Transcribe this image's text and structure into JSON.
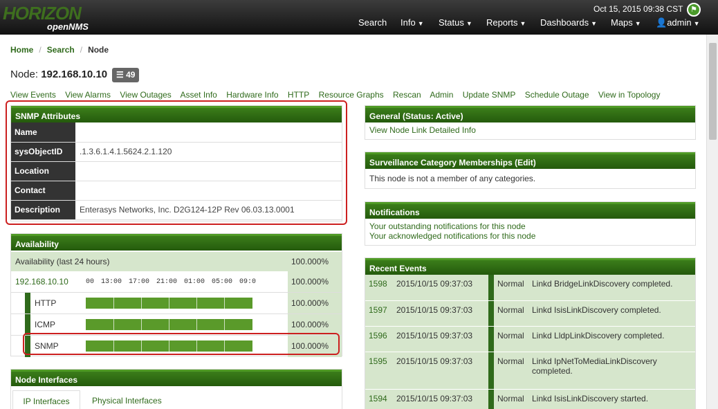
{
  "brand": {
    "name": "HORIZON",
    "sub": "openNMS"
  },
  "clock": "Oct 15, 2015 09:38 CST",
  "nav": [
    "Search",
    "Info",
    "Status",
    "Reports",
    "Dashboards",
    "Maps",
    "admin"
  ],
  "breadcrumb": [
    "Home",
    "Search",
    "Node"
  ],
  "node": {
    "label": "Node:",
    "ip": "192.168.10.10",
    "badge": "49"
  },
  "actions": [
    "View Events",
    "View Alarms",
    "View Outages",
    "Asset Info",
    "Hardware Info",
    "HTTP",
    "Resource Graphs",
    "Rescan",
    "Admin",
    "Update SNMP",
    "Schedule Outage",
    "View in Topology"
  ],
  "snmp": {
    "title": "SNMP Attributes",
    "rows": [
      {
        "k": "Name",
        "v": ""
      },
      {
        "k": "sysObjectID",
        "v": ".1.3.6.1.4.1.5624.2.1.120"
      },
      {
        "k": "Location",
        "v": ""
      },
      {
        "k": "Contact",
        "v": ""
      },
      {
        "k": "Description",
        "v": "Enterasys Networks, Inc. D2G124-12P Rev 06.03.13.0001"
      }
    ]
  },
  "availability": {
    "title": "Availability",
    "summary_label": "Availability (last 24 hours)",
    "summary_pct": "100.000%",
    "ip": "192.168.10.10",
    "ip_pct": "100.000%",
    "times": [
      "00",
      "13:00",
      "17:00",
      "21:00",
      "01:00",
      "05:00",
      "09:0"
    ],
    "services": [
      {
        "name": "HTTP",
        "pct": "100.000%"
      },
      {
        "name": "ICMP",
        "pct": "100.000%"
      },
      {
        "name": "SNMP",
        "pct": "100.000%"
      }
    ]
  },
  "interfaces": {
    "title": "Node Interfaces",
    "tabs": [
      "IP Interfaces",
      "Physical Interfaces"
    ]
  },
  "general": {
    "title": "General (Status: Active)",
    "link": "View Node Link Detailed Info"
  },
  "surveillance": {
    "title": "Surveillance Category Memberships (Edit)",
    "text": "This node is not a member of any categories."
  },
  "notifications": {
    "title": "Notifications",
    "items": [
      "Your outstanding notifications for this node",
      "Your acknowledged notifications for this node"
    ]
  },
  "events": {
    "title": "Recent Events",
    "rows": [
      {
        "id": "1598",
        "time": "2015/10/15 09:37:03",
        "sev": "Normal",
        "msg": "Linkd BridgeLinkDiscovery completed."
      },
      {
        "id": "1597",
        "time": "2015/10/15 09:37:03",
        "sev": "Normal",
        "msg": "Linkd IsisLinkDiscovery completed."
      },
      {
        "id": "1596",
        "time": "2015/10/15 09:37:03",
        "sev": "Normal",
        "msg": "Linkd LldpLinkDiscovery completed."
      },
      {
        "id": "1595",
        "time": "2015/10/15 09:37:03",
        "sev": "Normal",
        "msg": "Linkd IpNetToMediaLinkDiscovery completed."
      },
      {
        "id": "1594",
        "time": "2015/10/15 09:37:03",
        "sev": "Normal",
        "msg": "Linkd IsisLinkDiscovery started."
      }
    ]
  }
}
